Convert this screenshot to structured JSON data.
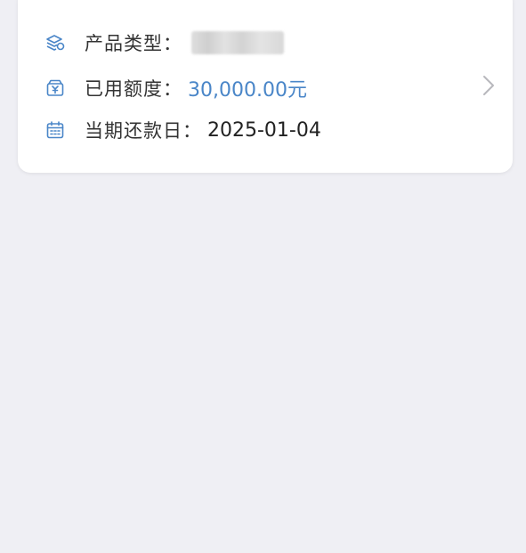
{
  "card": {
    "product_type": {
      "icon": "layers-coin-icon",
      "label": "产品类型：",
      "value": ""
    },
    "used_limit": {
      "icon": "yen-box-icon",
      "label": "已用额度：",
      "value": "30,000.00元"
    },
    "due_date": {
      "icon": "calendar-icon",
      "label": "当期还款日：",
      "value": "2025-01-04"
    },
    "chevron_icon": "chevron-right-icon"
  },
  "colors": {
    "page_bg": "#efeff4",
    "card_bg": "#ffffff",
    "accent_blue": "#4a86c8",
    "label_text": "#333333"
  }
}
